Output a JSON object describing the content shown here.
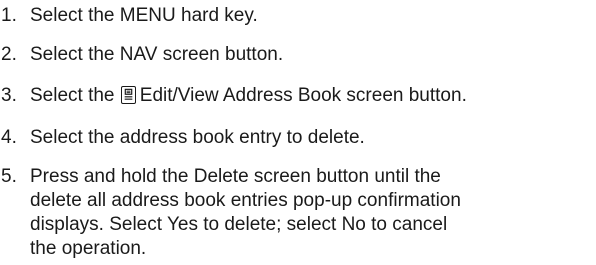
{
  "instructions": {
    "steps": [
      {
        "number": "1.",
        "lines": [
          "Select the MENU hard key."
        ]
      },
      {
        "number": "2.",
        "lines": [
          "Select the NAV screen button."
        ]
      },
      {
        "number": "3.",
        "before_icon": "Select the ",
        "icon": "address-book-icon",
        "after_icon": "Edit/View Address Book screen button."
      },
      {
        "number": "4.",
        "lines": [
          "Select the address book entry to delete."
        ]
      },
      {
        "number": "5.",
        "lines": [
          "Press and hold the Delete screen button until the",
          "delete all address book entries pop-up confirmation",
          "displays. Select Yes to delete; select No to cancel",
          "the operation."
        ]
      }
    ]
  }
}
